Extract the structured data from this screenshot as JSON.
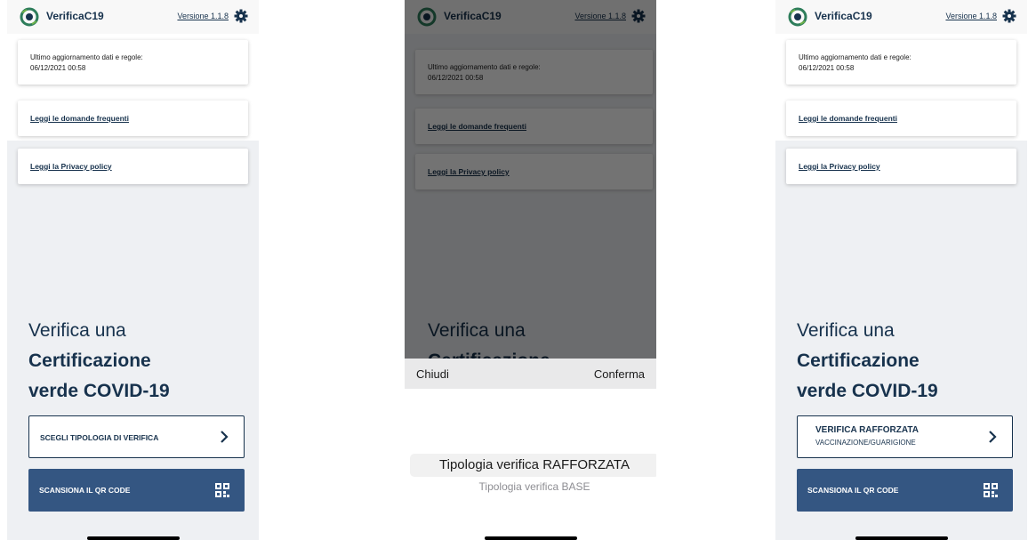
{
  "app": {
    "title": "VerificaC19",
    "version_link": "Versione 1.1.8"
  },
  "cards": {
    "update_line1": "Ultimo aggiornamento dati e regole:",
    "update_line2": "06/12/2021 00:58",
    "faq_link": "Leggi le domande frequenti",
    "privacy_link": "Leggi la Privacy policy"
  },
  "heading": {
    "line1": "Verifica una",
    "line2": "Certificazione",
    "line3": "verde COVID-19"
  },
  "screen1": {
    "choose_button": "SCEGLI TIPOLOGIA DI VERIFICA",
    "scan_button": "SCANSIONA IL QR CODE"
  },
  "screen2": {
    "picker_close": "Chiudi",
    "picker_confirm": "Conferma",
    "options": [
      "Tipologia verifica RAFFORZATA",
      "Tipologia verifica BASE"
    ],
    "selected_index": 0
  },
  "screen3": {
    "choose_button_title": "VERIFICA RAFFORZATA",
    "choose_button_subtitle": "VACCINAZIONE/GUARIGIONE",
    "scan_button": "SCANSIONA IL QR CODE"
  },
  "colors": {
    "primary": "#17324d",
    "button_fill": "#345682",
    "background": "#eef0f3"
  },
  "icons": [
    "app-logo-icon",
    "gear-icon",
    "chevron-right-icon",
    "qr-code-icon"
  ]
}
